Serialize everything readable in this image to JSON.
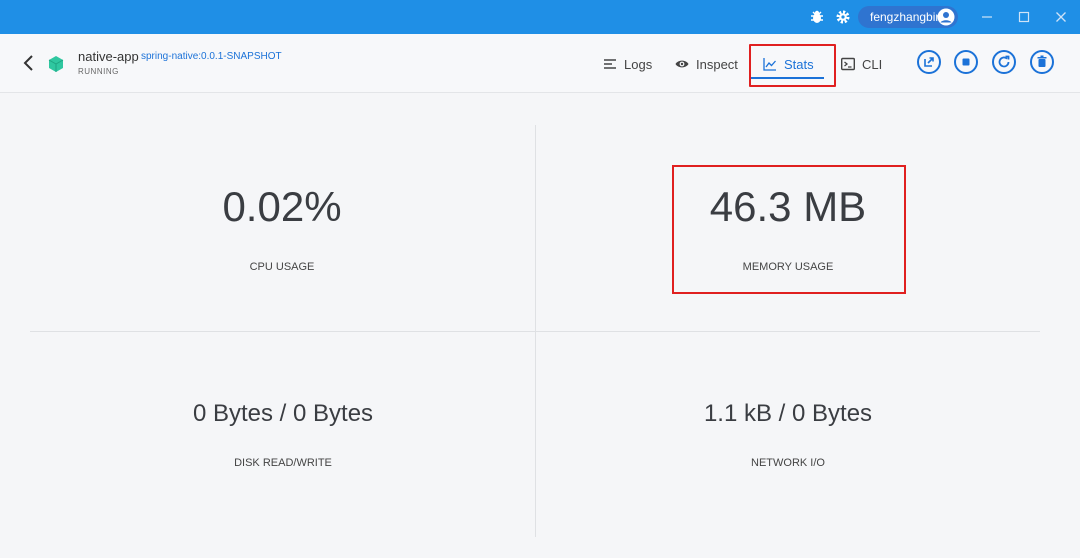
{
  "titlebar": {
    "username": "fengzhangbin",
    "icons": [
      "bug-icon",
      "gear-icon",
      "user-avatar-icon",
      "minimize-icon",
      "maximize-icon",
      "close-icon"
    ],
    "color": "#1f8fe6"
  },
  "header": {
    "app_name": "native-app",
    "image_tag": "spring-native:0.0.1-SNAPSHOT",
    "status": "RUNNING",
    "tabs": [
      {
        "label": "Logs",
        "icon": "logs-icon"
      },
      {
        "label": "Inspect",
        "icon": "eye-icon"
      },
      {
        "label": "Stats",
        "icon": "chart-icon",
        "active": true
      },
      {
        "label": "CLI",
        "icon": "terminal-icon"
      }
    ],
    "actions": [
      "open-in-browser-icon",
      "stop-icon",
      "restart-icon",
      "delete-icon"
    ],
    "accent": "#1b72d8"
  },
  "stats": {
    "cpu": {
      "value": "0.02%",
      "label": "CPU USAGE"
    },
    "memory": {
      "value": "46.3 MB",
      "label": "MEMORY USAGE"
    },
    "disk": {
      "value": "0 Bytes / 0 Bytes",
      "label": "DISK READ/WRITE"
    },
    "network": {
      "value": "1.1 kB / 0 Bytes",
      "label": "NETWORK I/O"
    }
  },
  "annotation_color": "#e02020"
}
